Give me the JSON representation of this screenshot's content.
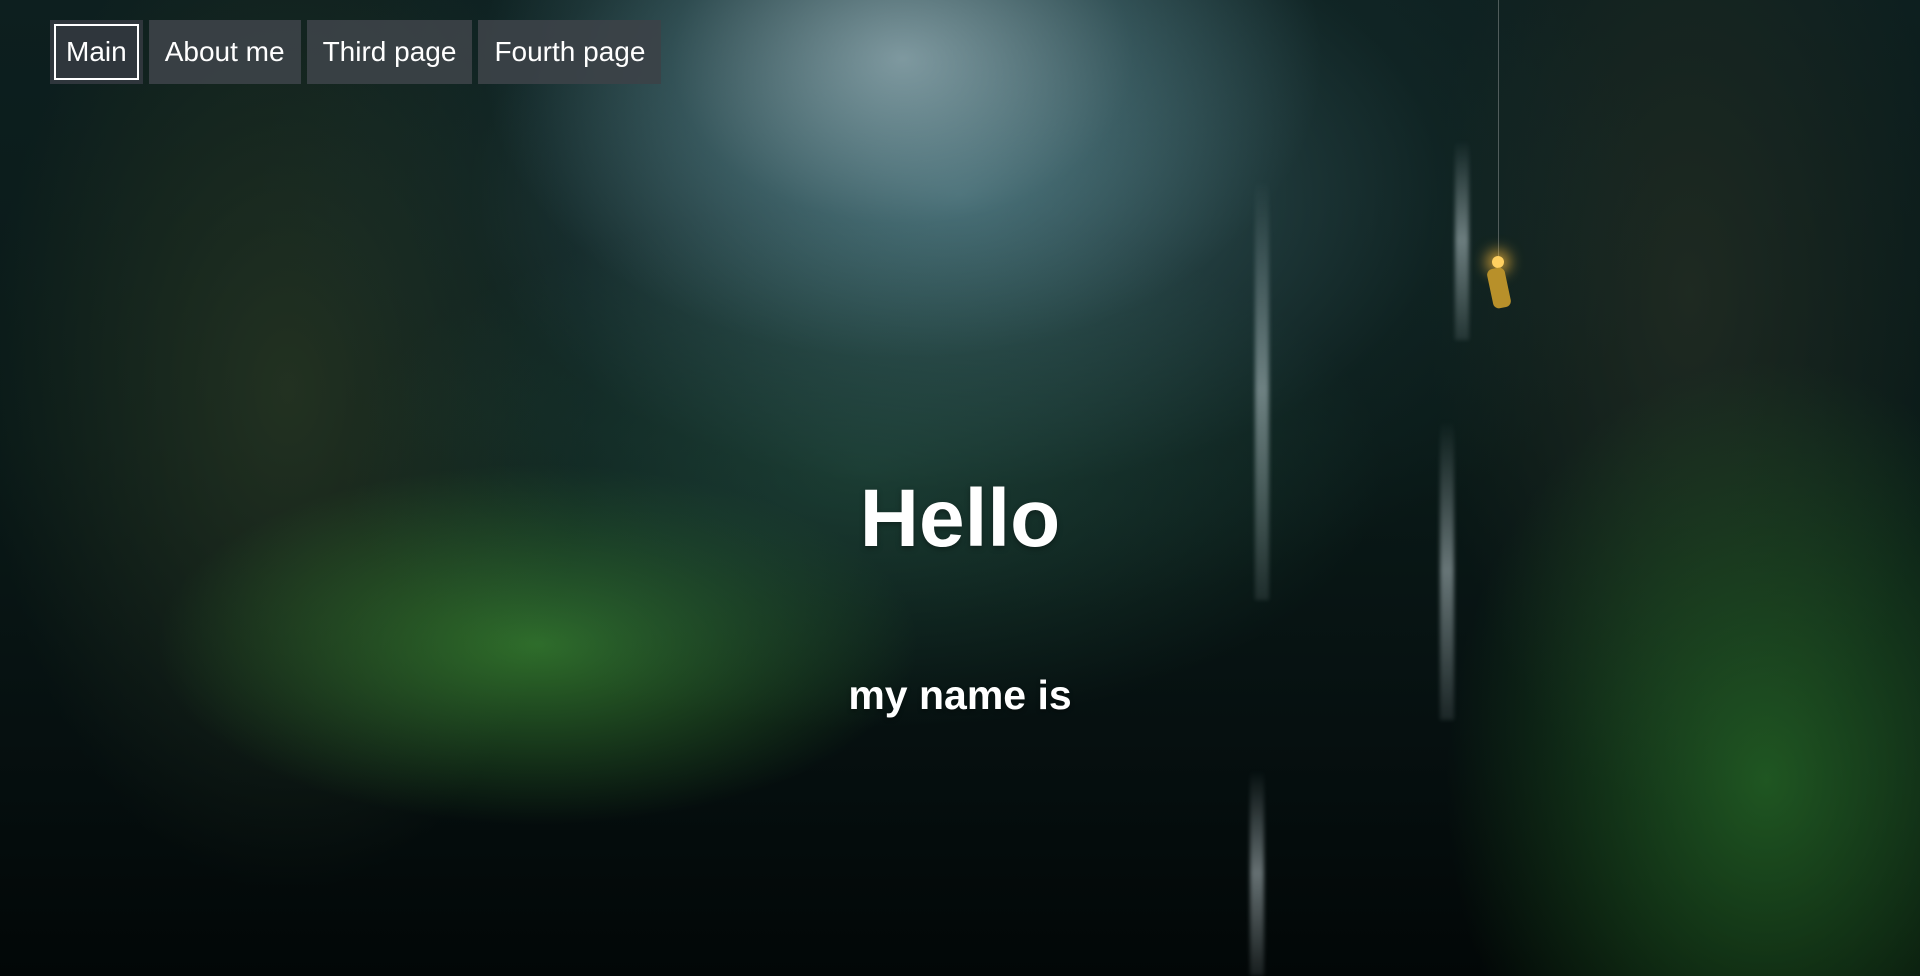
{
  "nav": {
    "items": [
      {
        "label": "Main",
        "active": true
      },
      {
        "label": "About me",
        "active": false
      },
      {
        "label": "Third page",
        "active": false
      },
      {
        "label": "Fourth page",
        "active": false
      }
    ]
  },
  "hero": {
    "title": "Hello",
    "subtitle": "my name is"
  },
  "colors": {
    "nav_background": "#3c4248",
    "nav_text": "#ffffff",
    "active_outline": "#ffffff",
    "heading_text": "#ffffff"
  }
}
